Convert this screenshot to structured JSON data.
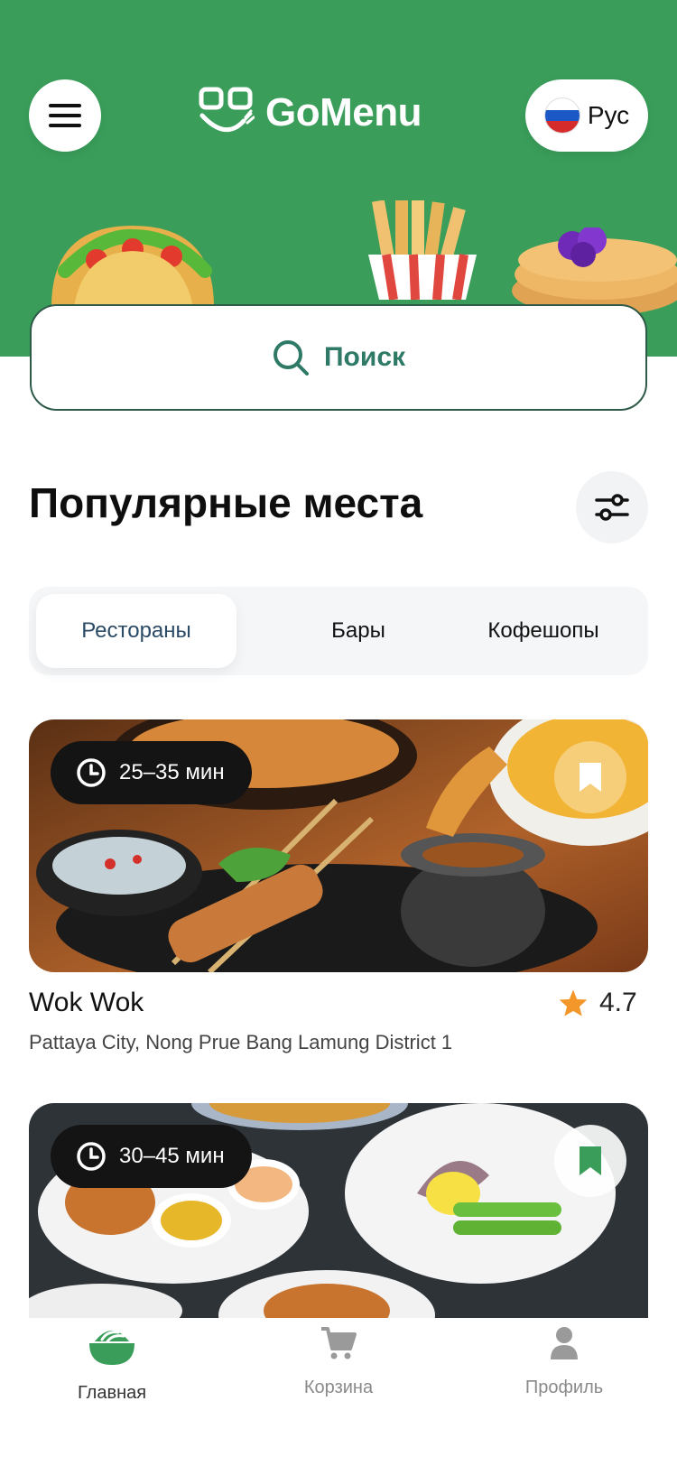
{
  "header": {
    "app_name": "GoMenu",
    "language_label": "Рус",
    "brand_color": "#3a9e5a"
  },
  "search": {
    "label": "Поиск"
  },
  "section": {
    "title": "Популярные места"
  },
  "tabs": [
    {
      "label": "Рестораны",
      "active": true
    },
    {
      "label": "Бары",
      "active": false
    },
    {
      "label": "Кофешопы",
      "active": false
    }
  ],
  "places": [
    {
      "time": "25–35 мин",
      "name": "Wok Wok",
      "rating": "4.7",
      "address": "Pattaya City, Nong Prue Bang Lamung District 1",
      "bookmarked": false
    },
    {
      "time": "30–45 мин",
      "bookmarked": true
    }
  ],
  "tabbar": [
    {
      "label": "Главная",
      "icon": "bowl-icon",
      "active": true
    },
    {
      "label": "Корзина",
      "icon": "cart-icon",
      "active": false
    },
    {
      "label": "Профиль",
      "icon": "profile-icon",
      "active": false
    }
  ]
}
